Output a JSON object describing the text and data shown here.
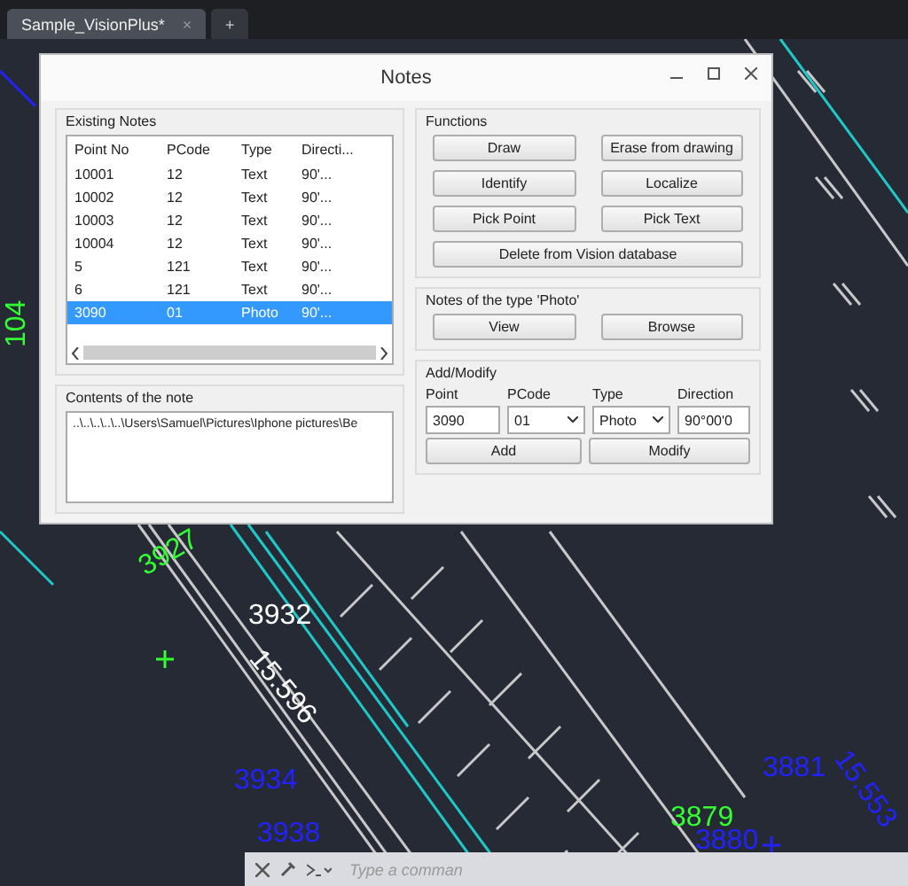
{
  "tabs": [
    {
      "label": "Sample_VisionPlus*",
      "selected": true,
      "close": "×"
    },
    {
      "label": "+",
      "selected": false
    }
  ],
  "drawing": {
    "labels": [
      {
        "text": "104",
        "color": "#33ff33"
      },
      {
        "text": "3927",
        "color": "#33ff33"
      },
      {
        "text": "3932",
        "color": "#ffffff"
      },
      {
        "text": "15.596",
        "color": "#ffffff"
      },
      {
        "text": "3934",
        "color": "#2222ff"
      },
      {
        "text": "3938",
        "color": "#2222ff"
      },
      {
        "text": "3881",
        "color": "#2222ff"
      },
      {
        "text": "15.553",
        "color": "#2222ff"
      },
      {
        "text": "3879",
        "color": "#33ff33"
      },
      {
        "text": "3880",
        "color": "#2222ff"
      }
    ]
  },
  "dialog": {
    "title": "Notes",
    "existing_notes": {
      "title": "Existing Notes",
      "columns": [
        "Point No",
        "PCode",
        "Type",
        "Directi..."
      ],
      "rows": [
        {
          "cells": [
            "10001",
            "12",
            "Text",
            "90'..."
          ],
          "selected": false
        },
        {
          "cells": [
            "10002",
            "12",
            "Text",
            "90'..."
          ],
          "selected": false
        },
        {
          "cells": [
            "10003",
            "12",
            "Text",
            "90'..."
          ],
          "selected": false
        },
        {
          "cells": [
            "10004",
            "12",
            "Text",
            "90'..."
          ],
          "selected": false
        },
        {
          "cells": [
            "5",
            "121",
            "Text",
            "90'..."
          ],
          "selected": false
        },
        {
          "cells": [
            "6",
            "121",
            "Text",
            "90'..."
          ],
          "selected": false
        },
        {
          "cells": [
            "3090",
            "01",
            "Photo",
            "90'..."
          ],
          "selected": true
        }
      ]
    },
    "contents": {
      "title": "Contents of the note",
      "value": "..\\..\\..\\..\\..\\Users\\Samuel\\Pictures\\Iphone pictures\\Be"
    },
    "functions": {
      "title": "Functions",
      "buttons": [
        "Draw",
        "Erase from drawing",
        "Identify",
        "Localize",
        "Pick Point",
        "Pick Text",
        "Delete from Vision database"
      ]
    },
    "photo_notes": {
      "title": "Notes of the type 'Photo'",
      "buttons": [
        "View",
        "Browse"
      ]
    },
    "add_modify": {
      "title": "Add/Modify",
      "fields": [
        {
          "label": "Point",
          "kind": "text",
          "value": "3090"
        },
        {
          "label": "PCode",
          "kind": "select",
          "value": "01"
        },
        {
          "label": "Type",
          "kind": "select",
          "value": "Photo"
        },
        {
          "label": "Direction",
          "kind": "text",
          "value": "90°00'0"
        }
      ],
      "buttons": [
        "Add",
        "Modify"
      ]
    }
  },
  "command_line": {
    "placeholder": "Type a comman"
  }
}
